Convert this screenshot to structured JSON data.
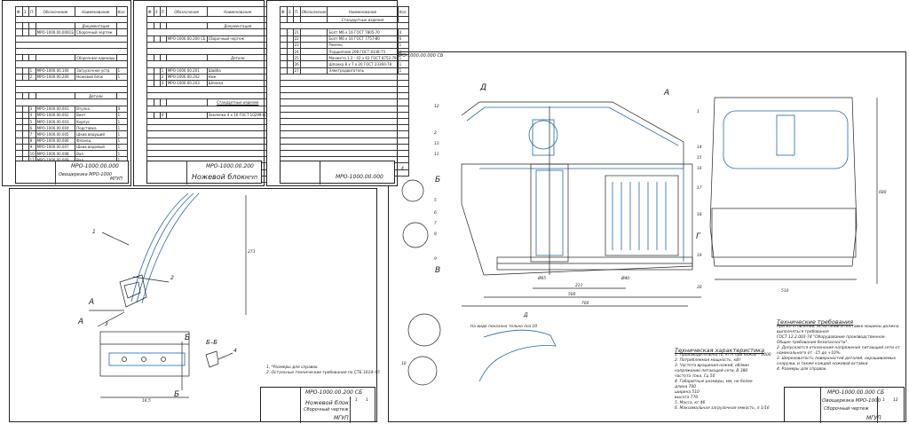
{
  "spec_headers": {
    "col_format": "Ф.",
    "col_zone": "З.",
    "col_pos": "П.",
    "col_designation": "Обозначение",
    "col_name": "Наименование",
    "col_qty": "Кол."
  },
  "sheet1": {
    "sections": [
      "Документация",
      "Сборочные единицы",
      "Детали"
    ],
    "docs": [
      {
        "designation": "МРО-1000.00.000СБ",
        "name": "Сборочный чертеж"
      }
    ],
    "units": [
      {
        "pos": "1",
        "designation": "МРО-1000.00.100",
        "name": "Загрузочное устр.",
        "qty": "1"
      },
      {
        "pos": "2",
        "designation": "МРО-1000.00.200",
        "name": "Ножевой блок",
        "qty": "1"
      }
    ],
    "details": [
      {
        "pos": "3",
        "designation": "МРО-1000.00.001",
        "name": "Втулка",
        "qty": "4"
      },
      {
        "pos": "4",
        "designation": "МРО-1000.00.002",
        "name": "Винт",
        "qty": "1"
      },
      {
        "pos": "5",
        "designation": "МРО-1000.00.003",
        "name": "Корпус",
        "qty": "1"
      },
      {
        "pos": "6",
        "designation": "МРО-1000.00.004",
        "name": "Подставка",
        "qty": "1"
      },
      {
        "pos": "7",
        "designation": "МРО-1000.00.005",
        "name": "Шкив ведущий",
        "qty": "1"
      },
      {
        "pos": "8",
        "designation": "МРО-1000.00.006",
        "name": "Фланец",
        "qty": "1"
      },
      {
        "pos": "9",
        "designation": "МРО-1000.00.007",
        "name": "Шкив ведомый",
        "qty": "1"
      },
      {
        "pos": "10",
        "designation": "МРО-1000.00.008",
        "name": "Вал",
        "qty": "1"
      },
      {
        "pos": "11",
        "designation": "МРО-1000.00.009",
        "name": "Вал",
        "qty": "1"
      },
      {
        "pos": "12",
        "designation": "МРО-1000.00.010",
        "name": "Крышка",
        "qty": "1"
      }
    ],
    "tb_code": "МРО-1000.00.000",
    "tb_title": "Овощерезка МРО-1000",
    "tb_org": "МГУП"
  },
  "sheet2": {
    "sections": [
      "Документация",
      "Детали",
      "Стандартные изделия"
    ],
    "docs": [
      {
        "designation": "МРО-1000.00.200 СБ",
        "name": "Сборочный чертеж"
      }
    ],
    "details": [
      {
        "pos": "1",
        "designation": "МРО-1000.00.201",
        "name": "Шайба",
        "qty": "1"
      },
      {
        "pos": "2",
        "designation": "МРО-1000.00.202",
        "name": "Нож",
        "qty": "1"
      },
      {
        "pos": "3",
        "designation": "МРО-1000.00.203",
        "name": "Шпонка",
        "qty": "1"
      }
    ],
    "standard": [
      {
        "pos": "4",
        "name": "Заклепка 4 х 16 ГОСТ 10299-80",
        "qty": "8"
      }
    ],
    "tb_code": "МРО-1000.00.200",
    "tb_title": "Ножевой блок",
    "tb_org": "МГУП"
  },
  "sheet3": {
    "sections": [
      "Стандартные изделия"
    ],
    "standard": [
      {
        "pos": "21",
        "name": "Болт М6 х 16 ГОСТ 7805-70",
        "qty": "4"
      },
      {
        "pos": "22",
        "name": "Болт М6 х 16 ГОСТ 7757-80",
        "qty": "6"
      },
      {
        "pos": "23",
        "name": "Ремень",
        "qty": "1"
      },
      {
        "pos": "24",
        "name": "Подшипник 208 ГОСТ 8338-75",
        "qty": "2"
      },
      {
        "pos": "25",
        "name": "Манжета 1.2 - 42 х 62 ГОСТ 8752-79",
        "qty": "1"
      },
      {
        "pos": "26",
        "name": "Шпонка 8 х 7 х 20 ГОСТ 23360-78",
        "qty": "1"
      },
      {
        "pos": "27",
        "name": "Электродвигатель",
        "qty": "1"
      }
    ],
    "tb_code": "МРО-1000.00.000"
  },
  "knife_drawing": {
    "callouts": [
      "1",
      "2",
      "3",
      "4"
    ],
    "views": [
      "А",
      "А",
      "Б",
      "Б",
      "Б–Б"
    ],
    "dims": [
      "273",
      "16,5"
    ],
    "notes": [
      "1. *Размеры для справок.",
      "2. Остальные технические требования по СТБ 1014–95"
    ],
    "tb_code": "МРО-1000.00.200 СБ",
    "tb_title": "Ножевой блок",
    "tb_subtitle": "Сборочный чертеж",
    "tb_org": "МГУП",
    "tb_sheet": "1",
    "tb_sheets": "1"
  },
  "main_drawing": {
    "stamp_code": "МРО-1000.00.000 СБ",
    "section_labels": [
      "Д",
      "А",
      "Б",
      "В",
      "Г",
      "Д"
    ],
    "callouts_left": [
      "12",
      "2",
      "13",
      "11",
      "4",
      "5",
      "6",
      "7",
      "8",
      "9",
      "10"
    ],
    "callouts_right": [
      "1",
      "14",
      "15",
      "16",
      "17",
      "18",
      "19",
      "20"
    ],
    "dims": [
      "Ø65",
      "Ø40",
      "211",
      "500",
      "700",
      "510",
      "600"
    ],
    "view_note": "На виде показана только поз 10",
    "tech_char_title": "Техническая характеристика",
    "tech_char_lines": [
      "1. Производительность, кг/ч при ножах – 1000",
      "2. Потребляемая мощность, кВт",
      "3. Частота вращения ножей, об/мин",
      "   напряжение питающей сети, В   380",
      "   частота тока, Гц   50",
      "4. Габаритные размеры, мм, не более",
      "   длина   700",
      "   ширина   510",
      "   высота   770",
      "5. Масса, кг   46",
      "6. Максимальная загрузочная емкость, л   1/16"
    ],
    "tech_req_title": "Технические требования",
    "tech_req_lines": [
      "При изготовлении, испытании и поставке машины должна",
      "выполняться требования",
      "ГОСТ 12.2.003-74 \"Оборудование производственное.",
      "Общие требования безопасности\".",
      "2. Допускается отклонение напряжения питающей сети от",
      "номинального от –15 до +10%.",
      "3. Шероховатость поверхностей деталей, окрашиваемых",
      "снаружи, и также каждой ножевой вставки",
      "4. Размеры для справок."
    ],
    "tb_code": "МРО-1000.00.000 СБ",
    "tb_title": "Овощерезка МРО-1000",
    "tb_subtitle": "Сборочный чертеж",
    "tb_org": "МГУП",
    "tb_sheet": "1",
    "tb_sheets": "12"
  }
}
